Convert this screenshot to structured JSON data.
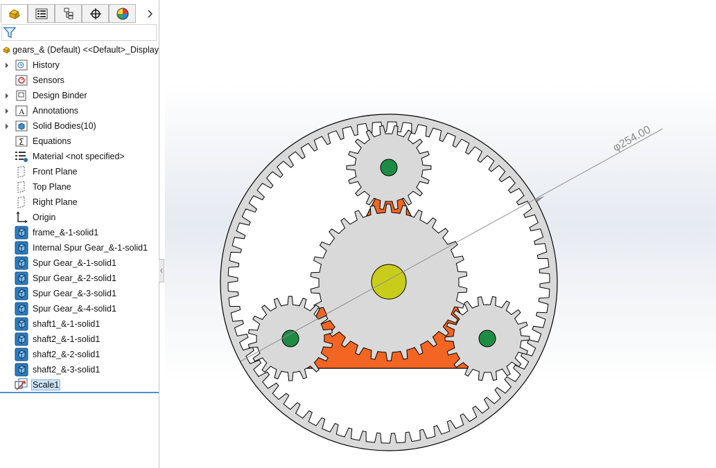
{
  "sidebar": {
    "tabs": [
      {
        "name": "feature-manager-tab",
        "icon": "feature-manager-icon"
      },
      {
        "name": "property-manager-tab",
        "icon": "property-manager-icon"
      },
      {
        "name": "configuration-manager-tab",
        "icon": "configuration-manager-icon"
      },
      {
        "name": "dimxpert-manager-tab",
        "icon": "dimxpert-icon"
      },
      {
        "name": "display-manager-tab",
        "icon": "display-manager-icon"
      }
    ],
    "filter_icon": "filter-icon",
    "root_label": "gears_& (Default) <<Default>_Display",
    "items": [
      {
        "label": "History",
        "icon": "history-icon",
        "expandable": true
      },
      {
        "label": "Sensors",
        "icon": "sensors-icon",
        "expandable": false
      },
      {
        "label": "Design Binder",
        "icon": "design-binder-icon",
        "expandable": true
      },
      {
        "label": "Annotations",
        "icon": "annotations-icon",
        "expandable": true
      },
      {
        "label": "Solid Bodies(10)",
        "icon": "solid-bodies-icon",
        "expandable": true
      },
      {
        "label": "Equations",
        "icon": "equations-icon",
        "expandable": false
      },
      {
        "label": "Material <not specified>",
        "icon": "material-icon",
        "expandable": false
      },
      {
        "label": "Front Plane",
        "icon": "plane-icon",
        "expandable": false
      },
      {
        "label": "Top Plane",
        "icon": "plane-icon",
        "expandable": false
      },
      {
        "label": "Right Plane",
        "icon": "plane-icon",
        "expandable": false
      },
      {
        "label": "Origin",
        "icon": "origin-icon",
        "expandable": false
      },
      {
        "label": "frame_&-1-solid1",
        "icon": "imported-body-icon",
        "expandable": false
      },
      {
        "label": "Internal Spur Gear_&-1-solid1",
        "icon": "imported-body-icon",
        "expandable": false
      },
      {
        "label": "Spur Gear_&-1-solid1",
        "icon": "imported-body-icon",
        "expandable": false
      },
      {
        "label": "Spur Gear_&-2-solid1",
        "icon": "imported-body-icon",
        "expandable": false
      },
      {
        "label": "Spur Gear_&-3-solid1",
        "icon": "imported-body-icon",
        "expandable": false
      },
      {
        "label": "Spur Gear_&-4-solid1",
        "icon": "imported-body-icon",
        "expandable": false
      },
      {
        "label": "shaft1_&-1-solid1",
        "icon": "imported-body-icon",
        "expandable": false
      },
      {
        "label": "shaft2_&-1-solid1",
        "icon": "imported-body-icon",
        "expandable": false
      },
      {
        "label": "shaft2_&-2-solid1",
        "icon": "imported-body-icon",
        "expandable": false
      },
      {
        "label": "shaft2_&-3-solid1",
        "icon": "imported-body-icon",
        "expandable": false
      },
      {
        "label": "Scale1",
        "icon": "scale-feature-icon",
        "expandable": false,
        "selected": true
      }
    ]
  },
  "viewport": {
    "dimension_text": "φ254.00",
    "colors": {
      "ring_gear": "#d9d9d9",
      "carrier_frame": "#f26522",
      "sun_gear": "#d9d9d9",
      "planet_gear": "#d9d9d9",
      "center_shaft": "#c8cc1a",
      "planet_shafts": "#1e8c45",
      "outline": "#000000"
    },
    "gears": {
      "ring_internal_teeth": 66,
      "sun_teeth": 30,
      "planet_teeth": 18
    }
  }
}
